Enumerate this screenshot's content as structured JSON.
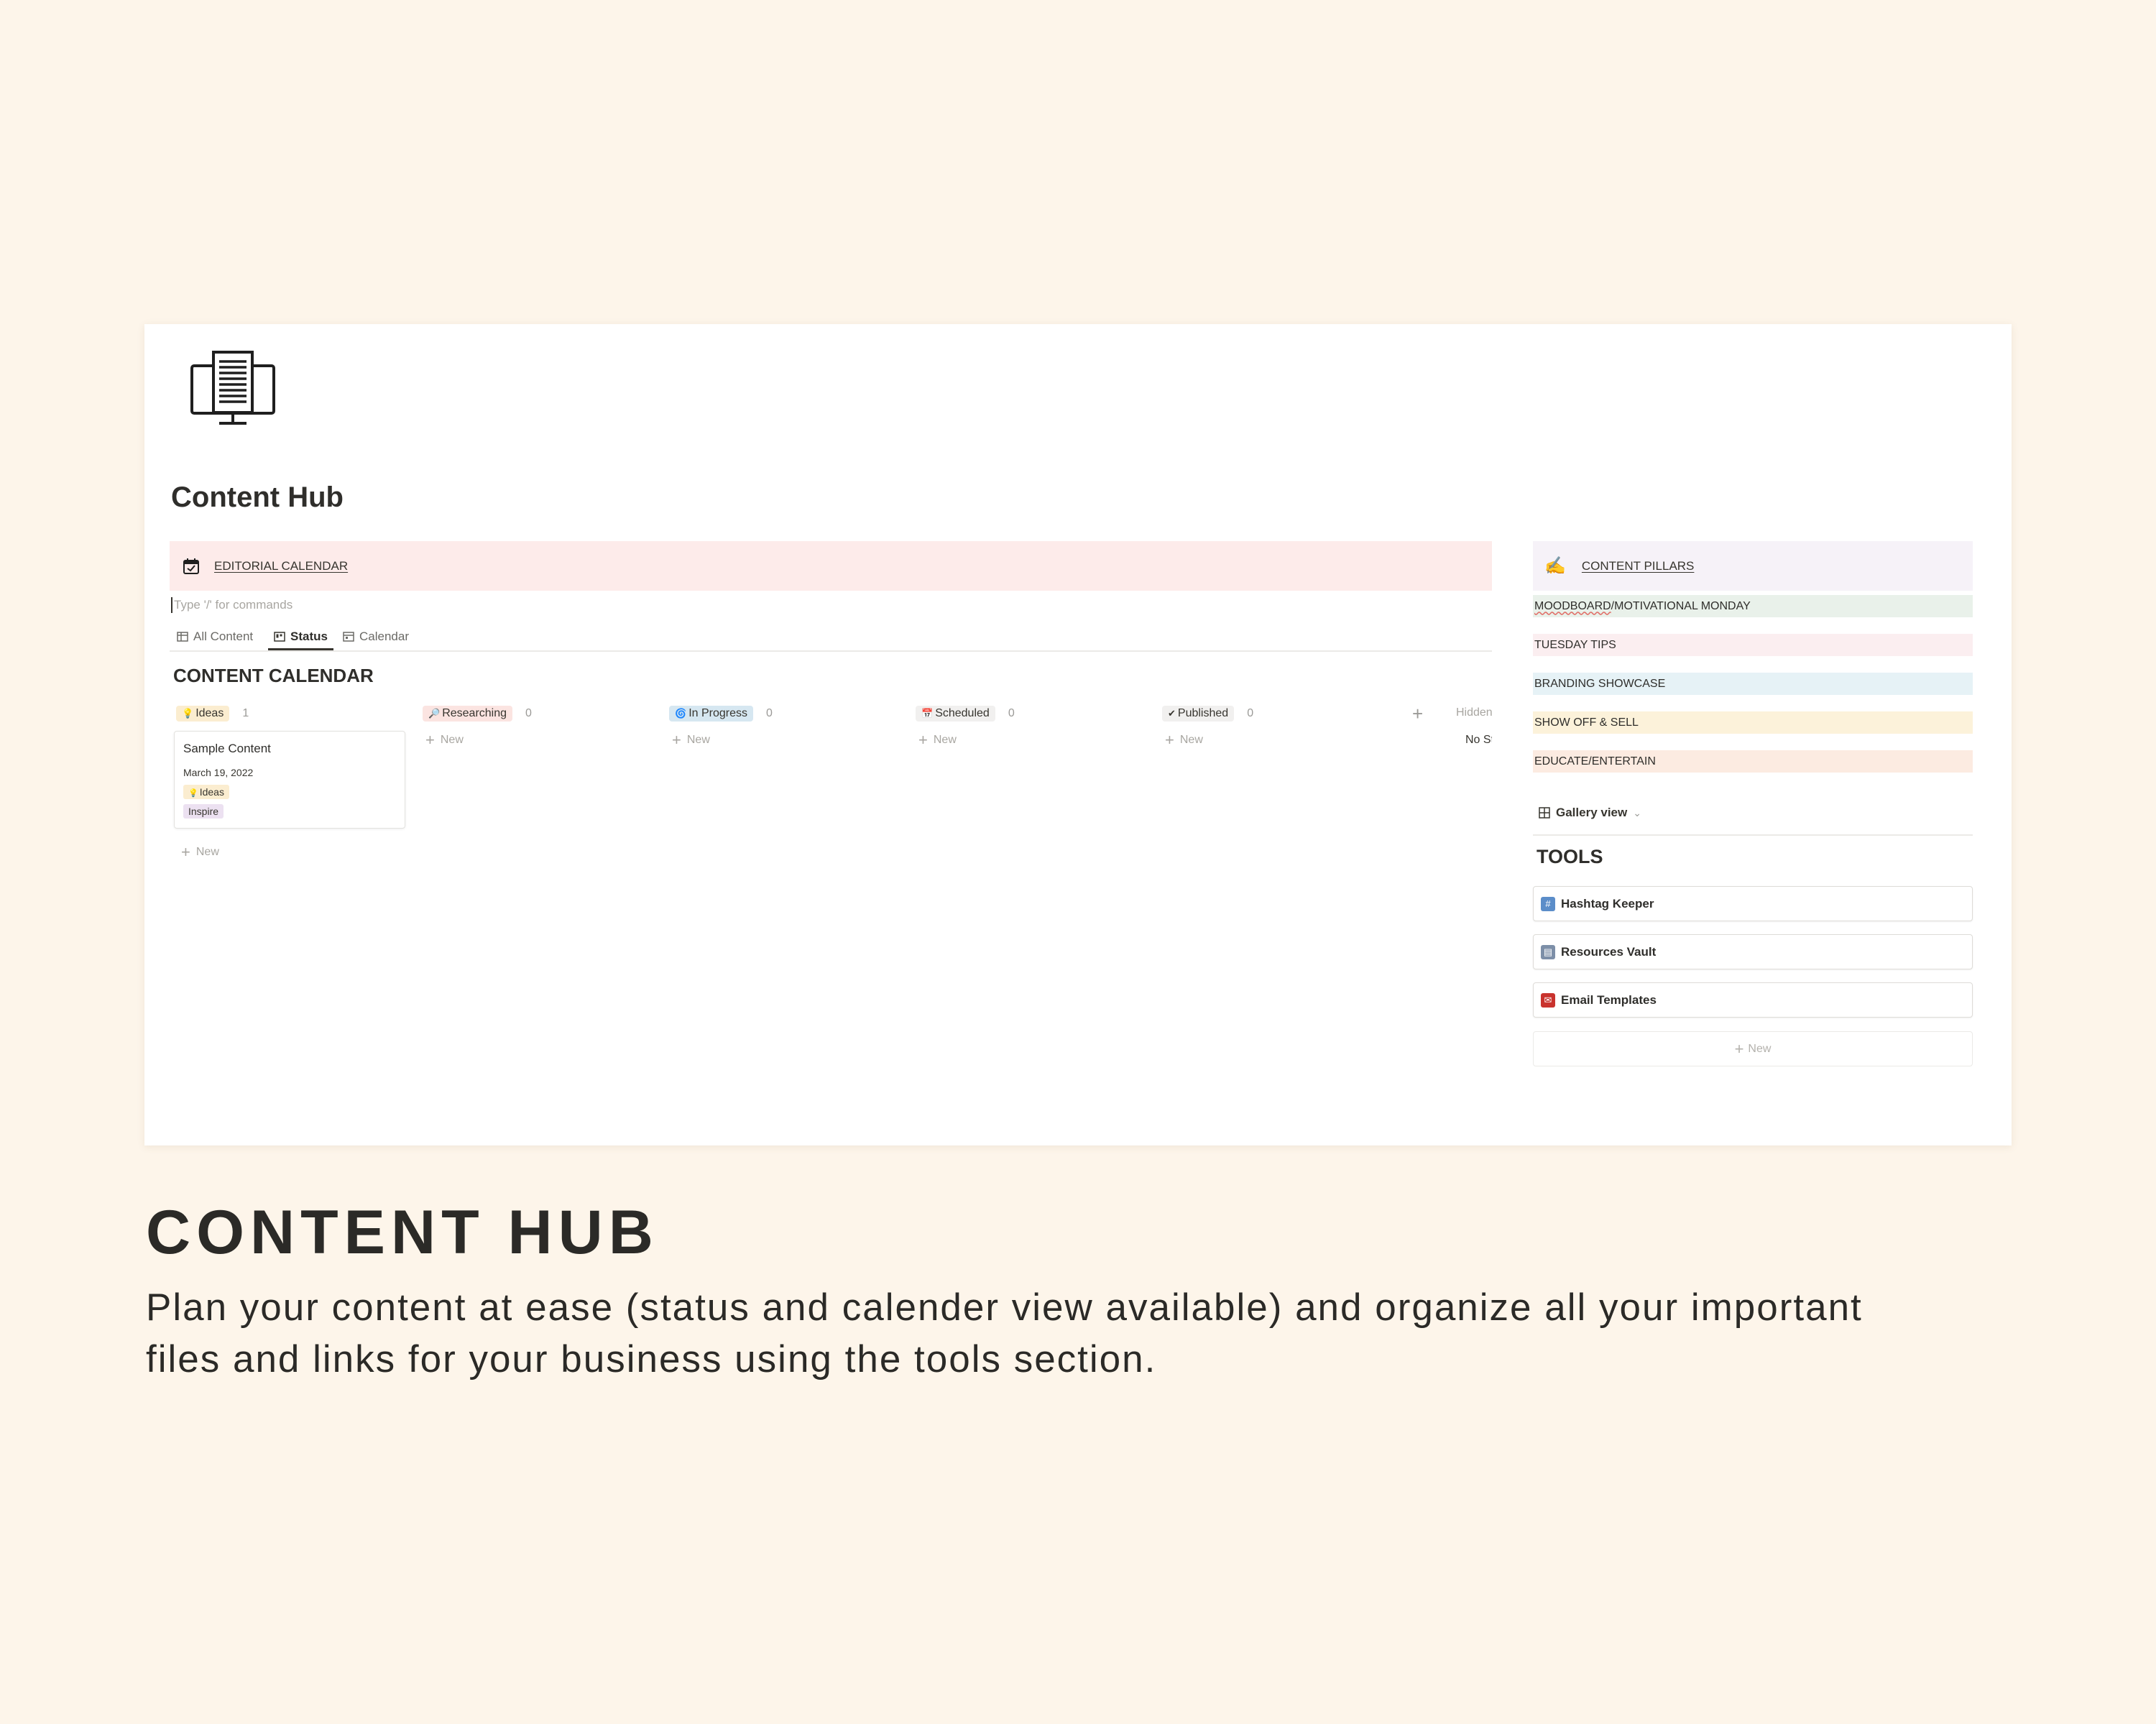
{
  "page": {
    "title": "Content Hub",
    "icon": "computer-document-icon"
  },
  "editorial_calendar": {
    "icon": "calendar-check-icon",
    "label": "EDITORIAL CALENDAR",
    "placeholder": "Type '/' for commands"
  },
  "tabs": [
    {
      "label": "All Content",
      "icon": "table-icon",
      "active": false
    },
    {
      "label": "Status",
      "icon": "board-icon",
      "active": true
    },
    {
      "label": "Calendar",
      "icon": "calendar-icon",
      "active": false
    }
  ],
  "board": {
    "title": "CONTENT CALENDAR",
    "columns": [
      {
        "label": "Ideas",
        "emoji": "💡",
        "count": "1",
        "bg": "#fbedd0"
      },
      {
        "label": "Researching",
        "emoji": "🔎",
        "count": "0",
        "bg": "#fbe4e1"
      },
      {
        "label": "In Progress",
        "emoji": "🌀",
        "count": "0",
        "bg": "#d6e7f1"
      },
      {
        "label": "Scheduled",
        "emoji": "📅",
        "count": "0",
        "bg": "#f1f0ef"
      },
      {
        "label": "Published",
        "emoji": "✔",
        "count": "0",
        "bg": "#f1f0ef"
      }
    ],
    "new_label": "New",
    "hidden_label": "Hidden groups",
    "hidden_row_label": "No Status",
    "card": {
      "title": "Sample Content",
      "date": "March 19, 2022",
      "tag_status": "Ideas",
      "tag_status_emoji": "💡",
      "tag_pillar": "Inspire"
    }
  },
  "content_pillars": {
    "icon": "writing-hand-icon",
    "label": "CONTENT PILLARS",
    "items": [
      {
        "label_a": "MOODBOARD",
        "label_b": "/MOTIVATIONAL MONDAY",
        "bg": "#e9f1ea"
      },
      {
        "label_a": "TUESDAY TIPS",
        "label_b": "",
        "bg": "#fbeef0"
      },
      {
        "label_a": "BRANDING SHOWCASE",
        "label_b": "",
        "bg": "#e6f2f6"
      },
      {
        "label_a": "SHOW OFF & SELL",
        "label_b": "",
        "bg": "#fcf2da"
      },
      {
        "label_a": "EDUCATE/ENTERTAIN",
        "label_b": "",
        "bg": "#fcebe1"
      }
    ]
  },
  "tools": {
    "view_label": "Gallery view",
    "title": "TOOLS",
    "items": [
      {
        "label": "Hashtag Keeper",
        "icon": "hashtag-icon",
        "glyph": "#",
        "color": "#5b8dc9"
      },
      {
        "label": "Resources Vault",
        "icon": "file-box-icon",
        "glyph": "▤",
        "color": "#7d8fa8"
      },
      {
        "label": "Email Templates",
        "icon": "mailbox-icon",
        "glyph": "✉",
        "color": "#c9332e"
      }
    ],
    "new_label": "New"
  },
  "caption": {
    "title": "CONTENT HUB",
    "body": "Plan your content at ease (status and calender view available) and organize all your important files and links for your business using the tools section."
  }
}
